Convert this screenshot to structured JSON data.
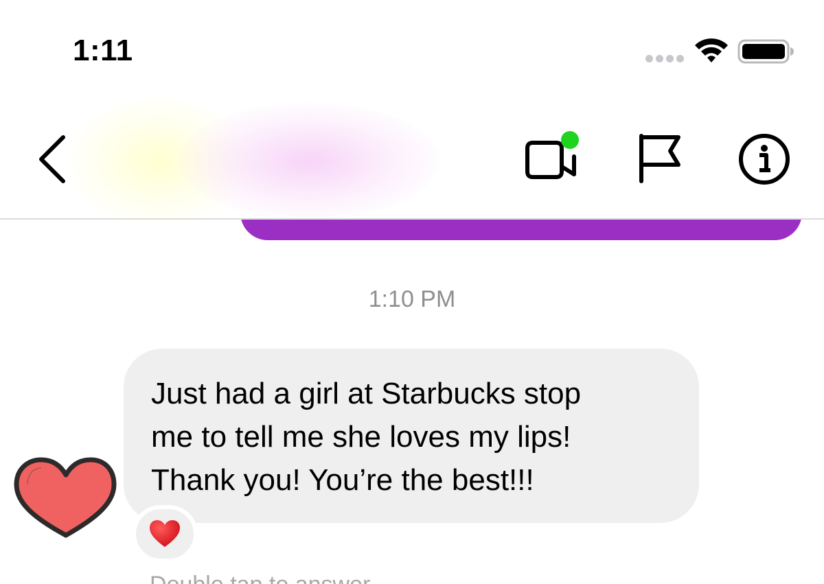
{
  "status_bar": {
    "time": "1:11",
    "signal_icon": "signal-dots-icon",
    "wifi_icon": "wifi-icon",
    "battery_icon": "battery-icon"
  },
  "header": {
    "back_icon": "chevron-left-icon",
    "video_call_icon": "video-camera-icon",
    "video_call_active_color": "#1ed41e",
    "flag_icon": "flag-icon",
    "info_icon": "info-icon"
  },
  "conversation": {
    "sent_bubble_color": "#9b2fc4",
    "timestamp": "1:10 PM",
    "received_message": {
      "text": "Just had a girl at Starbucks stop\nme to tell me she loves my lips!\nThank you! You’re the best!!!",
      "bubble_color": "#efefef",
      "reaction": "❤️"
    },
    "sticker": "heart-sticker",
    "sticker_color": "#f06262",
    "footer_partial": "Double tap to answer"
  }
}
